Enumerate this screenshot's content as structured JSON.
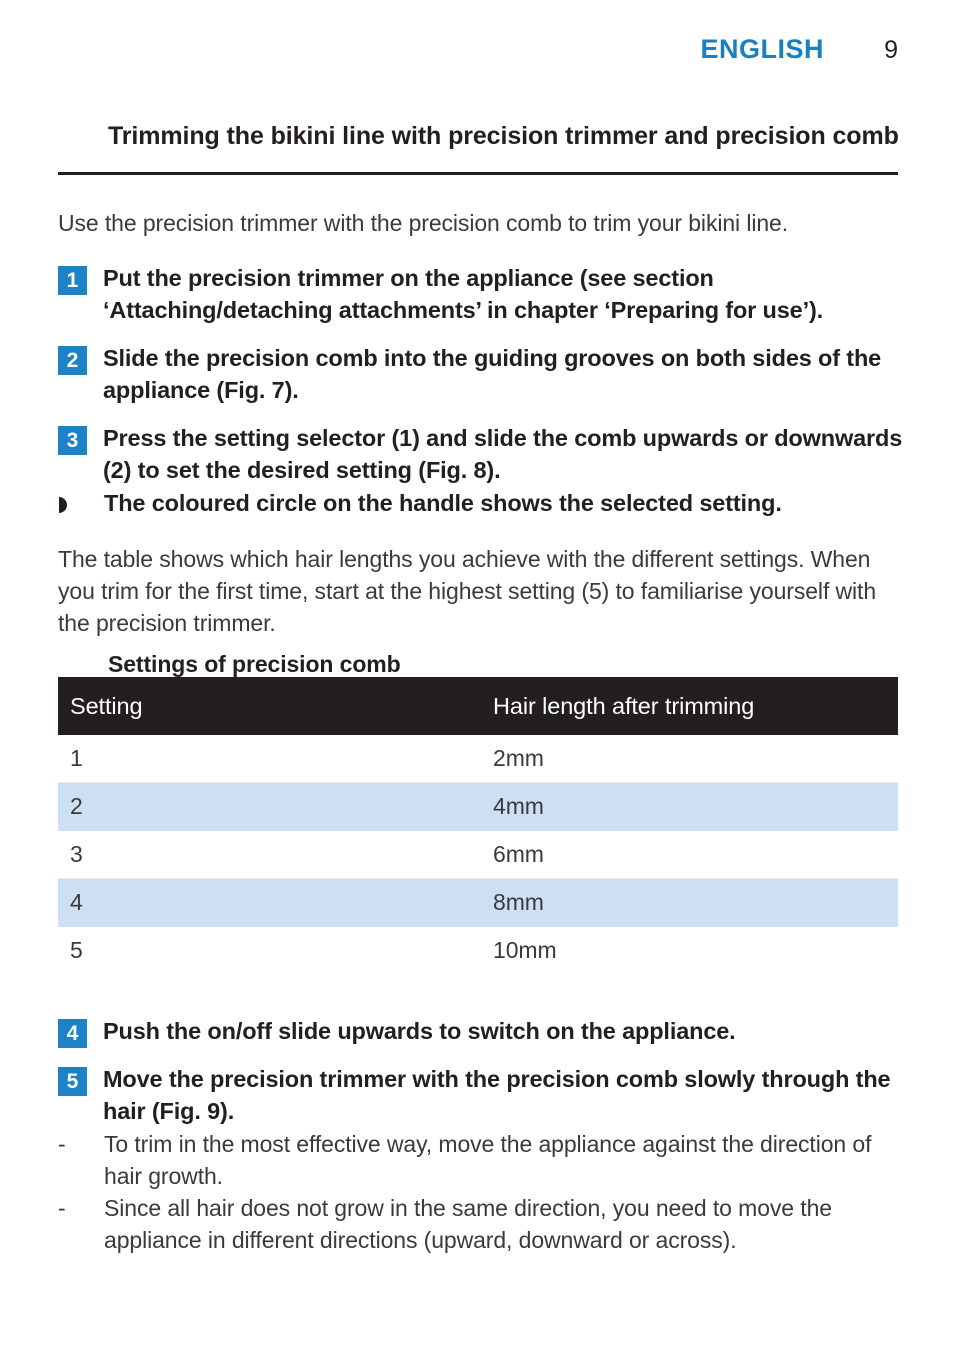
{
  "header": {
    "language": "ENGLISH",
    "page_number": "9"
  },
  "section": {
    "title": "Trimming the bikini line with precision trimmer and precision comb",
    "intro": "Use the precision trimmer with the precision comb to trim your bikini line."
  },
  "steps": [
    {
      "number": "1",
      "text": "Put the precision trimmer on the appliance (see section ‘Attaching/detaching attachments’ in chapter ‘Preparing for use’)."
    },
    {
      "number": "2",
      "text": "Slide the precision comb into the guiding grooves on both sides of the appliance (Fig. 7)."
    },
    {
      "number": "3",
      "text": "Press the setting selector (1) and slide the comb upwards or downwards (2) to set the desired setting (Fig. 8)."
    },
    {
      "number": "4",
      "text": "Push the on/off slide upwards to switch on the appliance."
    },
    {
      "number": "5",
      "text": "Move the precision trimmer with the precision comb slowly through the hair (Fig. 9)."
    }
  ],
  "arrow_note": {
    "marker": "half-disc-bullet",
    "text": "The coloured circle on the handle shows the selected setting."
  },
  "table_note": "The table shows which hair lengths you achieve with the different settings. When you trim for the first time, start at the highest setting (5) to familiarise yourself with the precision trimmer.",
  "table": {
    "heading": "Settings of precision comb",
    "columns": [
      "Setting",
      "Hair length after trimming"
    ],
    "rows": [
      [
        "1",
        "2mm"
      ],
      [
        "2",
        "4mm"
      ],
      [
        "3",
        "6mm"
      ],
      [
        "4",
        "8mm"
      ],
      [
        "5",
        "10mm"
      ]
    ]
  },
  "dash_notes": [
    {
      "marker": "-",
      "text": "To trim in the most effective way, move the appliance against the direction of hair growth."
    },
    {
      "marker": "-",
      "text": "Since all hair does not grow in the same direction, you need to move the appliance in different directions (upward, downward or across)."
    }
  ],
  "colors": {
    "accent_blue": "#1a7fc1",
    "badge_blue": "#1d82c6",
    "table_header_dark": "#231f20",
    "table_alt_row": "#cddff2"
  }
}
